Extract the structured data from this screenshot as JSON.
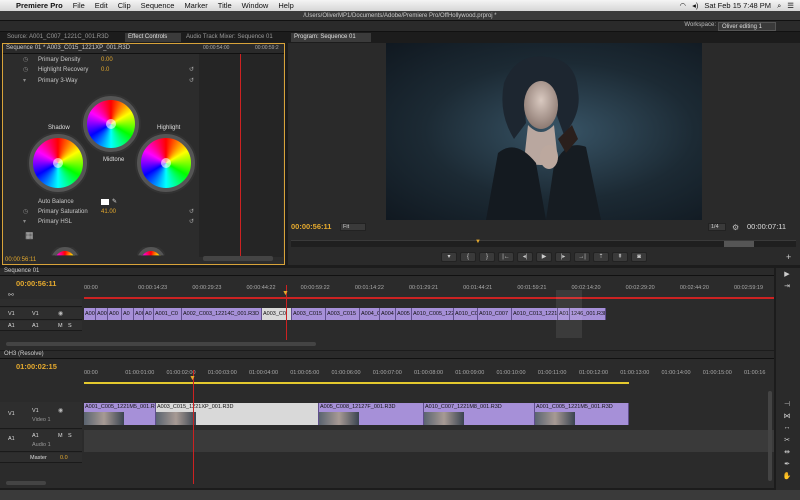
{
  "menubar": {
    "app_name": "Premiere Pro",
    "items": [
      "File",
      "Edit",
      "Clip",
      "Sequence",
      "Marker",
      "Title",
      "Window",
      "Help"
    ],
    "clock": "Sat Feb 15  7:48 PM"
  },
  "window_title": "/Users/OliverMP1/Documents/Adobe/Premiere Pro/OffHollywood.prproj *",
  "workspace": {
    "label": "Workspace:",
    "value": "Oliver editing 1"
  },
  "panels": {
    "source_tab": "Source: A001_C007_1221C_001.R3D",
    "effect_controls_tab": "Effect Controls",
    "audio_mixer_tab": "Audio Track Mixer: Sequence 01",
    "program_tab": "Program: Sequence 01"
  },
  "effect_controls": {
    "sequence_label": "Sequence 01 * A003_C015_1221XP_001.R3D",
    "mini_tc_start": "00:00:54:00",
    "mini_tc_end": "00:00:59:2",
    "rows": [
      {
        "label": "Primary Density",
        "value": "0.00"
      },
      {
        "label": "Highlight Recovery",
        "value": "0.0"
      },
      {
        "label": "Primary 3-Way",
        "value": ""
      }
    ],
    "wheel_labels": {
      "shadow": "Shadow",
      "midtone": "Midtone",
      "highlight": "Highlight"
    },
    "auto_balance": "Auto Balance",
    "primary_saturation": {
      "label": "Primary Saturation",
      "value": "41.00"
    },
    "primary_hsl": "Primary HSL",
    "timecode": "00:00:56:11"
  },
  "program": {
    "timecode": "00:00:56:11",
    "fit": "Fit",
    "quality": "1/4",
    "duration": "00:00:07:11"
  },
  "source_timeline": {
    "tab": "Sequence 01",
    "timecode": "00:00:56:11",
    "ruler": [
      "00:00",
      "00:00:14:23",
      "00:00:29:23",
      "00:00:44:22",
      "00:00:59:22",
      "00:01:14:22",
      "00:01:29:21",
      "00:01:44:21",
      "00:01:59:21",
      "00:02:14:20",
      "00:02:29:20",
      "00:02:44:20",
      "00:02:59:19"
    ],
    "tracks": [
      "V1",
      "A1"
    ],
    "clips": [
      "A001",
      "A00",
      "A00",
      "A0",
      "A00",
      "A0",
      "A001_C0",
      "A002_C003_12214C_001.R3D",
      "A003_C0",
      "A003_C015",
      "A003_C015",
      "A004_C",
      "A004",
      "A005",
      "A010_C005_1221M2",
      "A010_C00",
      "A010_C007",
      "A010_C013_1221",
      "A01",
      "1246_001.R3D"
    ]
  },
  "main_timeline": {
    "tab": "OH3 (Resolve)",
    "timecode": "01:00:02:15",
    "ruler": [
      "00:00",
      "01:00:01:00",
      "01:00:02:00",
      "01:00:03:00",
      "01:00:04:00",
      "01:00:05:00",
      "01:00:06:00",
      "01:00:07:00",
      "01:00:08:00",
      "01:00:09:00",
      "01:00:10:00",
      "01:00:11:00",
      "01:00:12:00",
      "01:00:13:00",
      "01:00:14:00",
      "01:00:15:00",
      "01:00:16"
    ],
    "video_track_label": "Video 1",
    "audio_track_label": "Audio 1",
    "master_label": "Master",
    "master_value": "0.0",
    "clips": [
      "A001_C005_1221M5_001.R3D",
      "A003_C015_1221XP_001.R3D",
      "A005_C008_12127F_001.R3D",
      "A010_C007_1221M8_001.R3D",
      "A001_C005_1221M5_001.R3D"
    ]
  },
  "colors": {
    "accent": "#e4a92e",
    "clip_purple": "#a690d8",
    "playhead": "#cc2222"
  }
}
